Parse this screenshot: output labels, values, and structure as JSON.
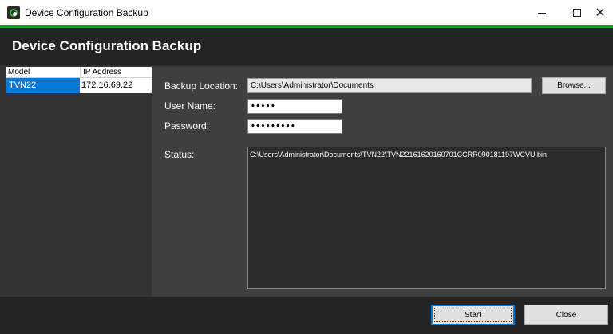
{
  "window": {
    "title": "Device Configuration Backup",
    "close_glyph": "✕",
    "icon": "app-icon"
  },
  "header": {
    "title": "Device Configuration Backup"
  },
  "device_list": {
    "columns": [
      "Model",
      "IP Address"
    ],
    "rows": [
      {
        "model": "TVN22",
        "ip": "172.16.69.22",
        "selected": true
      }
    ]
  },
  "form": {
    "backup_location_label": "Backup Location:",
    "backup_location_value": "C:\\Users\\Administrator\\Documents",
    "browse_label": "Browse...",
    "user_name_label": "User Name:",
    "user_name_value": "•••••",
    "password_label": "Password:",
    "password_value": "•••••••••",
    "status_label": "Status:",
    "status_value": "C:\\Users\\Administrator\\Documents\\TVN22\\TVN22161620160701CCRR090181197WCVU.bin"
  },
  "footer": {
    "start_label": "Start",
    "close_label": "Close"
  },
  "colors": {
    "accent_green": "#1e9c1e",
    "selection_blue": "#0a78d7",
    "panel_dark": "#242424"
  }
}
